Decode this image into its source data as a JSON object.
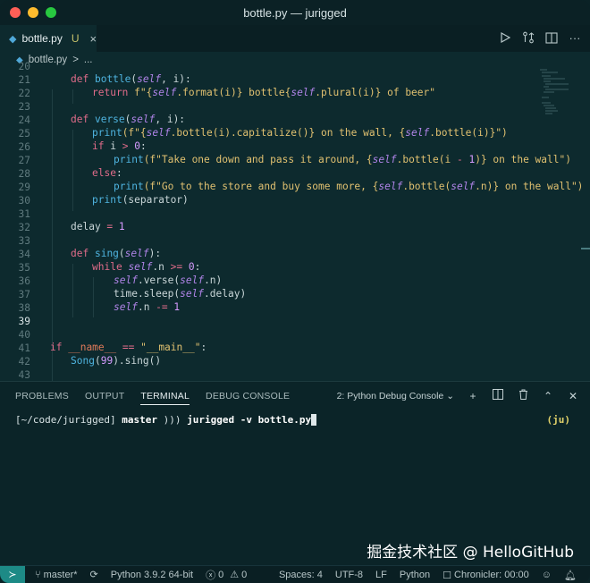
{
  "window": {
    "title": "bottle.py — jurigged"
  },
  "tab": {
    "icon": "python-file-icon",
    "name": "bottle.py",
    "modified": "U",
    "close": "×"
  },
  "breadcrumb": {
    "file": "bottle.py",
    "sep": ">",
    "more": "..."
  },
  "editor": {
    "current_line": "39",
    "lines": [
      {
        "n": "20"
      },
      {
        "n": "21"
      },
      {
        "n": "22"
      },
      {
        "n": "23"
      },
      {
        "n": "24"
      },
      {
        "n": "25"
      },
      {
        "n": "26"
      },
      {
        "n": "27"
      },
      {
        "n": "28"
      },
      {
        "n": "29"
      },
      {
        "n": "30"
      },
      {
        "n": "31"
      },
      {
        "n": "32"
      },
      {
        "n": "33"
      },
      {
        "n": "34"
      },
      {
        "n": "35"
      },
      {
        "n": "36"
      },
      {
        "n": "37"
      },
      {
        "n": "38"
      },
      {
        "n": "39"
      },
      {
        "n": "40"
      },
      {
        "n": "41"
      },
      {
        "n": "42"
      },
      {
        "n": "43"
      }
    ],
    "code": {
      "l21_def": "def",
      "l21_fn": "bottle",
      "l21_a": "(",
      "l21_self": "self",
      "l21_b": ", i):",
      "l22_ret": "return",
      "l22_s1": "f\"{",
      "l22_self1": "self",
      "l22_s2": ".format(i)} bottle{",
      "l22_self2": "self",
      "l22_s3": ".plural(i)} of beer\"",
      "l24_def": "def",
      "l24_fn": "verse",
      "l24_a": "(",
      "l24_self": "self",
      "l24_b": ", i):",
      "l25_print": "print",
      "l25_a": "(f\"{",
      "l25_self1": "self",
      "l25_b": ".bottle(i).capitalize()} on the wall, {",
      "l25_self2": "self",
      "l25_c": ".bottle(i)}\")",
      "l26_if": "if",
      "l26_a": " i ",
      "l26_op": ">",
      "l26_num": " 0",
      "l26_b": ":",
      "l27_print": "print",
      "l27_a": "(f\"Take one down and pass it around, {",
      "l27_self": "self",
      "l27_b": ".bottle(i ",
      "l27_op": "-",
      "l27_num": " 1",
      "l27_c": ")} on the wall\")",
      "l28_else": "else",
      "l28_b": ":",
      "l29_print": "print",
      "l29_a": "(f\"Go to the store and buy some more, {",
      "l29_self1": "self",
      "l29_b": ".bottle(",
      "l29_self2": "self",
      "l29_c": ".n)} on the wall\")",
      "l30_print": "print",
      "l30_a": "(separator)",
      "l32_a": "delay ",
      "l32_op": "=",
      "l32_num": " 1",
      "l34_def": "def",
      "l34_fn": "sing",
      "l34_a": "(",
      "l34_self": "self",
      "l34_b": "):",
      "l35_while": "while",
      "l35_self": "self",
      "l35_a": ".n ",
      "l35_op": ">=",
      "l35_num": " 0",
      "l35_b": ":",
      "l36_self1": "self",
      "l36_a": ".verse(",
      "l36_self2": "self",
      "l36_b": ".n)",
      "l37_a": "time.sleep(",
      "l37_self": "self",
      "l37_b": ".delay)",
      "l38_self": "self",
      "l38_a": ".n ",
      "l38_op": "-=",
      "l38_num": " 1",
      "l41_if": "if",
      "l41_name": "__name__",
      "l41_op": "==",
      "l41_str": "\"__main__\"",
      "l41_b": ":",
      "l42_cls": "Song",
      "l42_a": "(",
      "l42_num": "99",
      "l42_b": ").sing()"
    }
  },
  "panel": {
    "tabs": [
      "PROBLEMS",
      "OUTPUT",
      "TERMINAL",
      "DEBUG CONSOLE"
    ],
    "active_tab": "TERMINAL",
    "terminal_select": "2: Python Debug Console",
    "terminal": {
      "prompt": "[~/code/jurigged] ",
      "branch": "master",
      "arrows": " ))) ",
      "command": "jurigged -v bottle.py",
      "right": "(ju)"
    },
    "watermark": "掘金技术社区 @ HelloGitHub"
  },
  "status": {
    "branch": "master*",
    "python": "Python 3.9.2 64-bit",
    "errors": "0",
    "warnings": "0",
    "spaces": "Spaces: 4",
    "encoding": "UTF-8",
    "eol": "LF",
    "language": "Python",
    "chronicler": "Chronicler: 00:00"
  },
  "colors": {
    "background": "#0d2a2e",
    "keyword": "#e06c8a",
    "function": "#4fb4e0",
    "self": "#b084e8",
    "string": "#e0c070",
    "remote": "#1d8a86"
  }
}
